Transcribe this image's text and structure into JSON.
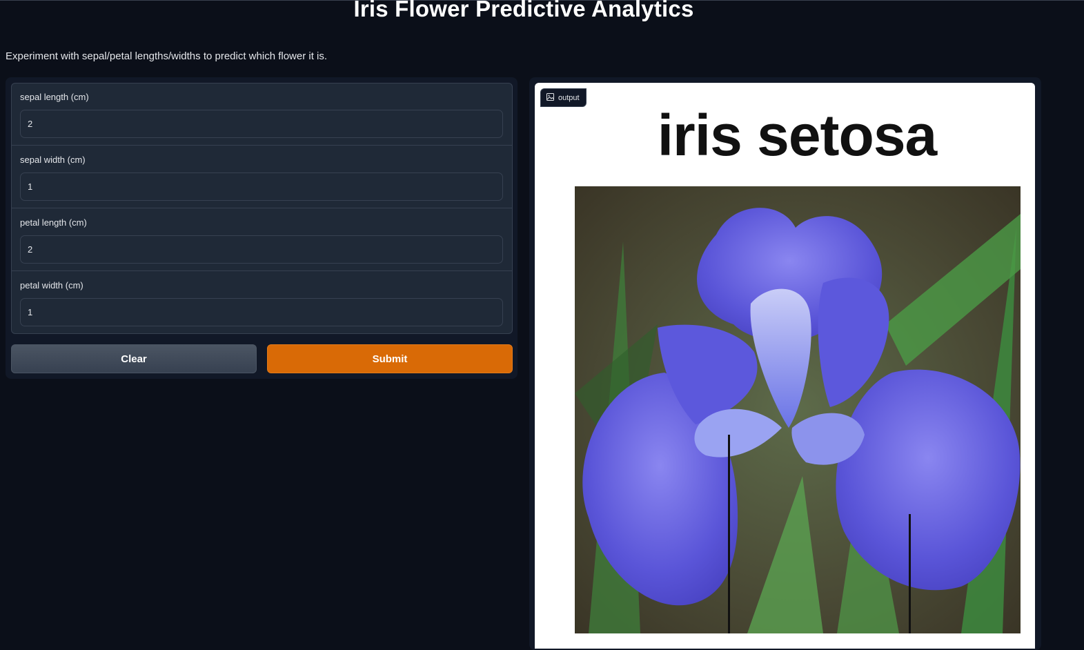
{
  "header": {
    "title": "Iris Flower Predictive Analytics",
    "description": "Experiment with sepal/petal lengths/widths to predict which flower it is."
  },
  "inputs": [
    {
      "label": "sepal length (cm)",
      "value": "2"
    },
    {
      "label": "sepal width (cm)",
      "value": "1"
    },
    {
      "label": "petal length (cm)",
      "value": "2"
    },
    {
      "label": "petal width (cm)",
      "value": "1"
    }
  ],
  "buttons": {
    "clear_label": "Clear",
    "submit_label": "Submit"
  },
  "output": {
    "tag_label": "output",
    "tag_icon": "image-icon",
    "prediction_text": "iris setosa",
    "image_subject": "iris flower photo"
  },
  "colors": {
    "background": "#0b0f19",
    "panel": "#111827",
    "submit_accent": "#d96a06"
  }
}
